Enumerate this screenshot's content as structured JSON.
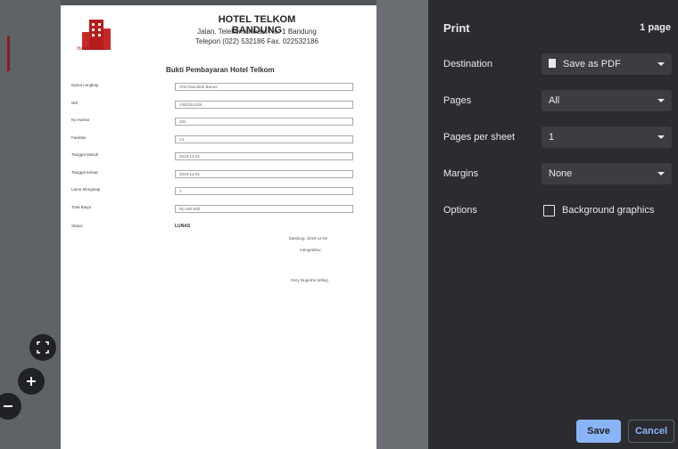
{
  "document": {
    "logo_text": "Hotel Telkom",
    "hotel_name": "HOTEL TELKOM BANDUNG",
    "address": "Jalan. Telekomunikasi No. 1 Bandung",
    "phone": "Telepon (022) 532186 Fax. 022532186",
    "heading": "Bukti Pembayaran Hotel Telkom",
    "fields": [
      {
        "label": "Nama Lengkap",
        "value": "Arbi Nasrullah Baruni"
      },
      {
        "label": "NIK",
        "value": "1402151235"
      },
      {
        "label": "No Kamar",
        "value": "101"
      },
      {
        "label": "Fasilitas",
        "value": "A1"
      },
      {
        "label": "Tanggal Masuk",
        "value": "2019-12-01"
      },
      {
        "label": "Tanggal Keluar",
        "value": "2019-12-01"
      },
      {
        "label": "Lama Menginap",
        "value": "1"
      },
      {
        "label": "Total Biaya",
        "value": "Rp.300.000"
      }
    ],
    "status_label": "Status",
    "status_value": "LUNAS",
    "sign_place_date": "bandung, 2019-12-02",
    "sign_role": "mengetahui",
    "sign_name": "Gery Nugroho Wiling"
  },
  "panel": {
    "title": "Print",
    "page_count": "1 page",
    "destination_label": "Destination",
    "destination_value": "Save as PDF",
    "pages_label": "Pages",
    "pages_value": "All",
    "pps_label": "Pages per sheet",
    "pps_value": "1",
    "margins_label": "Margins",
    "margins_value": "None",
    "options_label": "Options",
    "background_graphics_label": "Background graphics",
    "save_label": "Save",
    "cancel_label": "Cancel"
  },
  "colors": {
    "accent": "#8ab4f8",
    "panel_bg": "#2b2c30",
    "logo_red": "#b71c1c"
  },
  "icons": [
    "fit-page-icon",
    "zoom-in-icon",
    "zoom-out-icon",
    "pdf-file-icon",
    "dropdown-arrow-icon"
  ]
}
